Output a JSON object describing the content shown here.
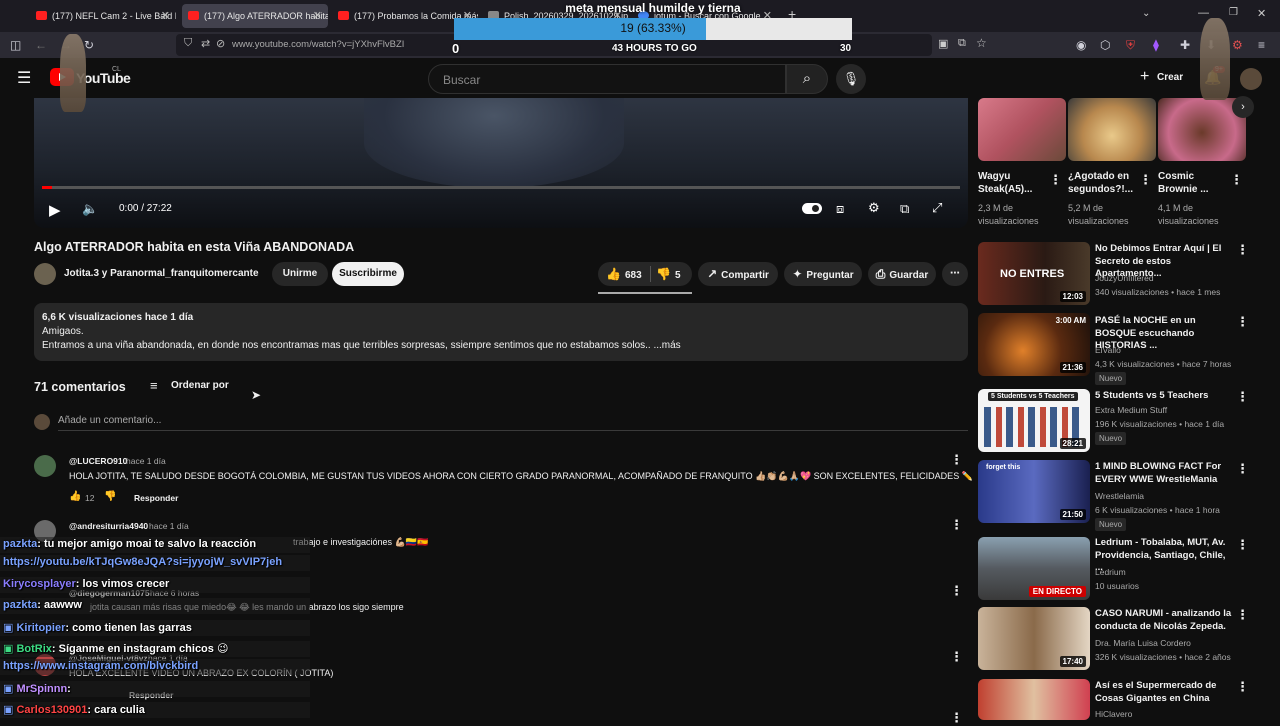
{
  "browser": {
    "tabs": [
      {
        "label": "(177) NEFL Cam 2 - Live Bald Ea",
        "close": "✕"
      },
      {
        "label": "(177) Algo ATERRADOR habita e",
        "close": "✕"
      },
      {
        "label": "(177) Probamos la Comida más",
        "close": "✕"
      },
      {
        "label": "Polish_20260329_20261029.jp",
        "close": "✕"
      },
      {
        "label": "jotum - Buscar con Google",
        "close": "✕"
      }
    ],
    "new_tab": "+",
    "url": "www.youtube.com/watch?v=jYXhvFlvBZI"
  },
  "goal": {
    "title": "meta mensual humilde y tierna",
    "value_label": "19 (63.33%)",
    "progress": 0.6333,
    "min": "0",
    "max": "30",
    "time_left": "43 HOURS TO GO"
  },
  "youtube": {
    "logo_text": "YouTube",
    "logo_country": "CL",
    "search_placeholder": "Buscar",
    "create_label": "Crear",
    "notif_count": "9+"
  },
  "player": {
    "time": "0:00 / 27:22"
  },
  "video": {
    "title": "Algo ATERRADOR habita en esta Viña ABANDONADA",
    "channel": "Jotita.3 y Paranormal_franquitomercante",
    "unirme": "Unirme",
    "subscribe": "Suscribirme",
    "likes": "683",
    "dislikes": "5",
    "share": "Compartir",
    "ask": "Preguntar",
    "save": "Guardar"
  },
  "description": {
    "meta": "6,6 K visualizaciones  hace 1 día",
    "line1": "Amigaos.",
    "line2": "Entramos a una viña abandonada, en donde nos encontramas mas que terribles sorpresas, ssiempre sentimos que no estabamos solos..  ...más"
  },
  "comments": {
    "count": "71 comentarios",
    "sort": "Ordenar por",
    "add_placeholder": "Añade un comentario...",
    "items": [
      {
        "user": "@LUCERO910",
        "time": "hace 1 día",
        "text": "HOLA JOTITA,  TE SALUDO DESDE BOGOTÁ COLOMBIA,  ME GUSTAN TUS VIDEOS AHORA CON CIERTO GRADO PARANORMAL, ACOMPAÑADO DE FRANQUITO 👍🏼👏🏼💪🏼🙏🏼💖  SON EXCELENTES, FELICIDADES ✏️",
        "likes": "12",
        "reply": "Responder"
      },
      {
        "user": "@andresiturria4940",
        "time": "hace 1 día",
        "text": "trabajo e investigaciónes 💪🏼🇨🇴🇪🇸"
      },
      {
        "user": "@diegogerman1075",
        "time": "hace 6 horas",
        "text": "jotita causan más risas que miedo😂 😂  les mando un abrazo los sigo siempre"
      },
      {
        "user": "@JoseMiguel-vt8vz",
        "time": "hace 1 día",
        "text": "HOLA EXCELENTE VIDEO UN ABRAZO EX COLORÍN ( JOTITA)",
        "reply": "Responder"
      }
    ]
  },
  "shorts": [
    {
      "title": "Wagyu Steak(A5)...",
      "views": "2,3 M de visualizaciones"
    },
    {
      "title": "¿Agotado en segundos?!...",
      "views": "5,2 M de visualizaciones"
    },
    {
      "title": "Cosmic Brownie ...",
      "views": "4,1 M de visualizaciones"
    }
  ],
  "recommended": [
    {
      "title": "No Debimos Entrar Aquí | El Secreto de estos Apartamento...",
      "channel": "JouzyUnfiltered",
      "meta": "340 visualizaciones • hace 1 mes",
      "duration": "12:03",
      "thumb_text": "NO ENTRES"
    },
    {
      "title": "PASÉ la NOCHE en un BOSQUE escuchando HISTORIAS ...",
      "channel": "ElVallo",
      "meta": "4,3 K visualizaciones • hace 7 horas",
      "duration": "21:36",
      "badge": "Nuevo",
      "thumb_text": "3:00 AM"
    },
    {
      "title": "5 Students vs 5 Teachers",
      "channel": "Extra Medium Stuff",
      "meta": "196 K visualizaciones • hace 1 día",
      "duration": "28:21",
      "badge": "Nuevo",
      "thumb_text": "5 Students vs 5 Teachers"
    },
    {
      "title": "1 MIND BLOWING FACT For EVERY WWE WrestleMania",
      "channel": "Wrestlelamia",
      "meta": "6 K visualizaciones • hace 1 hora",
      "duration": "21:50",
      "badge": "Nuevo",
      "thumb_text": "forget this"
    },
    {
      "title": "Ledrium - Tobalaba, MUT, Av. Providencia, Santiago, Chile, ...",
      "channel": "Ledrium",
      "meta": "10 usuarios",
      "live": "EN DIRECTO"
    },
    {
      "title": "CASO NARUMI - analizando la conducta de Nicolás Zepeda.",
      "channel": "Dra. María Luisa Cordero",
      "meta": "326 K visualizaciones • hace 2 años",
      "duration": "17:40"
    },
    {
      "title": "Así es el Supermercado de Cosas Gigantes en China",
      "channel": "HiClavero",
      "meta": ""
    }
  ],
  "chat": [
    {
      "user": "pazkta",
      "text": ": tu mejor amigo moai te salvo la reacción",
      "color": "#7aa2ff"
    },
    {
      "user": "",
      "text": "https://youtu.be/kTJqGw8eJQA?si=jyyojW_svVIP7jeh",
      "color": "#7aa2ff",
      "link": true
    },
    {
      "user": "Kirycosplayer",
      "text": ": los vimos crecer",
      "color": "#8a7dff"
    },
    {
      "user": "pazkta",
      "text": ": aawww",
      "color": "#7aa2ff"
    },
    {
      "user": "Kiritopier",
      "text": ": como tienen las garras",
      "color": "#7aa2ff"
    },
    {
      "user": "BotRix",
      "text": ": Síganme en instagram chicos 😉",
      "color": "#3ddc84"
    },
    {
      "user": "",
      "text": "https://www.instagram.com/blvckbird",
      "color": "#7aa2ff",
      "link": true
    },
    {
      "user": "MrSpinnn",
      "text": ":",
      "color": "#7aa2ff"
    },
    {
      "user": "Carlos130901",
      "text": ": cara culia",
      "color": "#ff4444"
    }
  ]
}
